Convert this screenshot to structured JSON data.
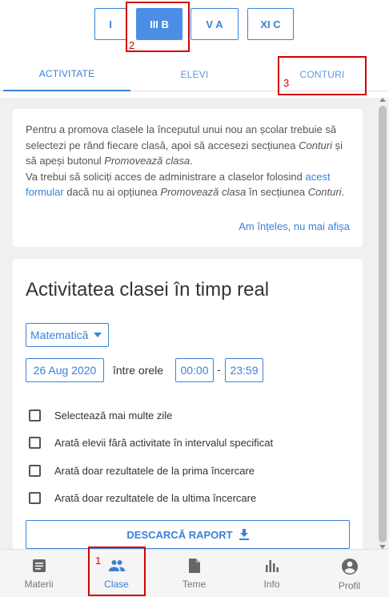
{
  "classes": [
    "I",
    "III B",
    "V A",
    "XI C"
  ],
  "active_class": "III B",
  "tabs": [
    {
      "label": "ACTIVITATE",
      "active": true
    },
    {
      "label": "ELEVI",
      "active": false
    },
    {
      "label": "CONTURI",
      "active": false
    }
  ],
  "annotations": [
    "1",
    "2",
    "3"
  ],
  "info": {
    "p1_a": "Pentru a promova clasele la începutul unui nou an școlar trebuie să selectezi pe rând fiecare clasă, apoi să accesezi secțiunea ",
    "p1_b": "Conturi",
    "p1_c": " și să apeși butonul ",
    "p1_d": "Promovează clasa",
    "p1_e": ".",
    "p2_a": "Va trebui să soliciți acces de administrare a claselor folosind ",
    "p2_link": "acest formular",
    "p2_b": " dacă nu ai opțiunea ",
    "p2_c": "Promovează clasa",
    "p2_d": " în secțiunea ",
    "p2_e": "Conturi",
    "p2_f": ".",
    "dismiss": "Am înțeles, nu mai afișa"
  },
  "activity": {
    "title": "Activitatea clasei în timp real",
    "subject": "Matematică",
    "date": "26 Aug 2020",
    "between_label": "între orele",
    "time_from": "00:00",
    "dash": "-",
    "time_to": "23:59",
    "checkboxes": [
      "Selectează mai multe zile",
      "Arată elevii fără activitate în intervalul specificat",
      "Arată doar rezultatele de la prima încercare",
      "Arată doar rezultatele de la ultima încercare"
    ],
    "report_button": "DESCARCĂ RAPORT"
  },
  "bottom_nav": [
    {
      "label": "Materii",
      "icon": "book-icon"
    },
    {
      "label": "Clase",
      "icon": "people-icon",
      "active": true
    },
    {
      "label": "Teme",
      "icon": "document-icon"
    },
    {
      "label": "Info",
      "icon": "chart-icon"
    },
    {
      "label": "Profil",
      "icon": "account-icon"
    }
  ],
  "colors": {
    "accent": "#3b82d6",
    "annotation": "#d40000"
  }
}
